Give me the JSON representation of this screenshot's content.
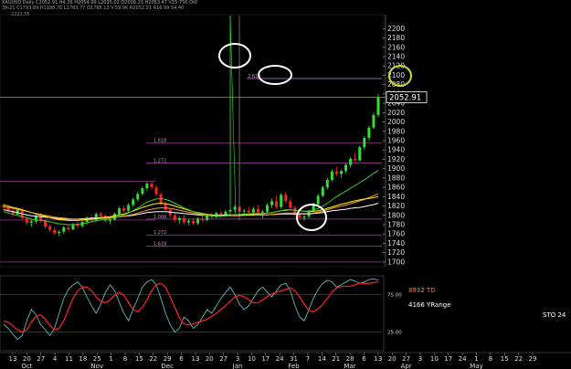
{
  "header": {
    "line1": "XAUUSD Daily C2052.91 H4.36 H2054.99 L2035.02 O2036.23 H2053.47 V15.75K Ot0",
    "line2": "39-21 C1793.89 H1188.76 L1783.77 O1788.12 V:59.9K R2052.51 R16.99 S4.40",
    "line3": "2222.55"
  },
  "last_price_label": "2052.91",
  "indicator_labels": {
    "td": "8932 TD",
    "yrange": "4166 YRange",
    "sto": "STO 24"
  },
  "fib_labels": [
    "2.618",
    "1.618",
    "1.272",
    "1.000",
    "1.272",
    "1.618"
  ],
  "fib_levels": [
    2093,
    1955,
    1912,
    1792,
    1758,
    1734
  ],
  "ma_colors": {
    "ma1": "#ffffff",
    "ma2": "#ff9933",
    "ma3": "#ffee00",
    "ma4": "#33cc33"
  },
  "chart_data": {
    "type": "candlestick",
    "price_axis": {
      "ylim": [
        1690,
        2230
      ],
      "ticks": [
        2200,
        2180,
        2160,
        2140,
        2120,
        2100,
        2080,
        2060,
        2040,
        2020,
        2000,
        1980,
        1960,
        1940,
        1920,
        1900,
        1880,
        1860,
        1840,
        1820,
        1800,
        1780,
        1760,
        1740,
        1720,
        1700
      ]
    },
    "date_axis": {
      "day_labels": [
        "13",
        "20",
        "27",
        "4",
        "11",
        "18",
        "25",
        "1",
        "8",
        "15",
        "22",
        "29",
        "6",
        "13",
        "20",
        "27",
        "3",
        "10",
        "17",
        "24",
        "31",
        "7",
        "14",
        "21",
        "28",
        "6",
        "13",
        "20",
        "27",
        "3",
        "10",
        "17",
        "24",
        "1",
        "8",
        "15",
        "22",
        "29"
      ],
      "month_labels": [
        {
          "label": "Oct",
          "index": 1
        },
        {
          "label": "Nov",
          "index": 6
        },
        {
          "label": "Dec",
          "index": 11
        },
        {
          "label": "Jan",
          "index": 16
        },
        {
          "label": "Feb",
          "index": 20
        },
        {
          "label": "Mar",
          "index": 24
        },
        {
          "label": "Apr",
          "index": 28
        },
        {
          "label": "May",
          "index": 33
        }
      ]
    },
    "candles": [
      [
        1822,
        1826,
        1812,
        1817
      ],
      [
        1817,
        1821,
        1806,
        1810
      ],
      [
        1810,
        1814,
        1798,
        1802
      ],
      [
        1802,
        1815,
        1800,
        1812
      ],
      [
        1812,
        1816,
        1790,
        1794
      ],
      [
        1794,
        1798,
        1780,
        1784
      ],
      [
        1784,
        1790,
        1775,
        1787
      ],
      [
        1787,
        1802,
        1782,
        1798
      ],
      [
        1798,
        1805,
        1785,
        1789
      ],
      [
        1789,
        1792,
        1772,
        1776
      ],
      [
        1776,
        1781,
        1765,
        1769
      ],
      [
        1769,
        1774,
        1758,
        1762
      ],
      [
        1762,
        1768,
        1755,
        1765
      ],
      [
        1765,
        1778,
        1760,
        1774
      ],
      [
        1774,
        1780,
        1766,
        1770
      ],
      [
        1770,
        1784,
        1768,
        1781
      ],
      [
        1781,
        1786,
        1772,
        1777
      ],
      [
        1777,
        1790,
        1773,
        1786
      ],
      [
        1786,
        1798,
        1780,
        1795
      ],
      [
        1795,
        1801,
        1786,
        1790
      ],
      [
        1790,
        1806,
        1787,
        1803
      ],
      [
        1803,
        1808,
        1795,
        1799
      ],
      [
        1799,
        1802,
        1784,
        1788
      ],
      [
        1788,
        1794,
        1781,
        1791
      ],
      [
        1791,
        1806,
        1788,
        1803
      ],
      [
        1803,
        1818,
        1800,
        1815
      ],
      [
        1815,
        1821,
        1806,
        1810
      ],
      [
        1810,
        1826,
        1806,
        1822
      ],
      [
        1822,
        1838,
        1818,
        1834
      ],
      [
        1834,
        1850,
        1830,
        1846
      ],
      [
        1846,
        1862,
        1842,
        1858
      ],
      [
        1858,
        1872,
        1852,
        1868
      ],
      [
        1868,
        1874,
        1855,
        1860
      ],
      [
        1860,
        1866,
        1840,
        1845
      ],
      [
        1845,
        1850,
        1820,
        1825
      ],
      [
        1825,
        1830,
        1808,
        1812
      ],
      [
        1812,
        1816,
        1796,
        1800
      ],
      [
        1800,
        1806,
        1785,
        1790
      ],
      [
        1790,
        1798,
        1782,
        1794
      ],
      [
        1794,
        1800,
        1780,
        1785
      ],
      [
        1785,
        1792,
        1779,
        1788
      ],
      [
        1788,
        1794,
        1780,
        1783
      ],
      [
        1783,
        1796,
        1780,
        1793
      ],
      [
        1793,
        1799,
        1786,
        1790
      ],
      [
        1790,
        1803,
        1787,
        1800
      ],
      [
        1800,
        1806,
        1792,
        1796
      ],
      [
        1796,
        1808,
        1794,
        1805
      ],
      [
        1805,
        1811,
        1795,
        1800
      ],
      [
        1800,
        1812,
        1798,
        1808
      ],
      [
        1808,
        2228,
        1800,
        1812
      ],
      [
        1812,
        1822,
        1806,
        1818
      ],
      [
        1818,
        1822,
        1804,
        1808
      ],
      [
        1808,
        1814,
        1798,
        1810
      ],
      [
        1810,
        1818,
        1804,
        1806
      ],
      [
        1806,
        1818,
        1800,
        1814
      ],
      [
        1814,
        1822,
        1802,
        1806
      ],
      [
        1806,
        1812,
        1794,
        1808
      ],
      [
        1808,
        1826,
        1804,
        1822
      ],
      [
        1822,
        1836,
        1816,
        1830
      ],
      [
        1830,
        1842,
        1814,
        1818
      ],
      [
        1818,
        1848,
        1814,
        1844
      ],
      [
        1844,
        1850,
        1826,
        1830
      ],
      [
        1830,
        1836,
        1812,
        1816
      ],
      [
        1816,
        1820,
        1798,
        1801
      ],
      [
        1801,
        1806,
        1792,
        1795
      ],
      [
        1795,
        1801,
        1788,
        1798
      ],
      [
        1798,
        1812,
        1794,
        1810
      ],
      [
        1810,
        1828,
        1806,
        1824
      ],
      [
        1824,
        1846,
        1820,
        1842
      ],
      [
        1842,
        1864,
        1838,
        1860
      ],
      [
        1860,
        1880,
        1855,
        1876
      ],
      [
        1876,
        1898,
        1872,
        1894
      ],
      [
        1894,
        1904,
        1884,
        1889
      ],
      [
        1889,
        1898,
        1880,
        1895
      ],
      [
        1895,
        1912,
        1890,
        1908
      ],
      [
        1908,
        1925,
        1902,
        1921
      ],
      [
        1921,
        1935,
        1914,
        1918
      ],
      [
        1918,
        1950,
        1915,
        1946
      ],
      [
        1946,
        1970,
        1940,
        1966
      ],
      [
        1966,
        1992,
        1960,
        1988
      ],
      [
        1988,
        2020,
        1984,
        2015
      ],
      [
        2015,
        2060,
        2010,
        2053
      ]
    ],
    "moving_averages": [
      {
        "name": "MA1",
        "color": "#ffffff",
        "values": [
          1812,
          1810,
          1808,
          1806,
          1803,
          1801,
          1799,
          1798,
          1797,
          1796,
          1795,
          1794,
          1793,
          1792,
          1792,
          1792,
          1792,
          1793,
          1793,
          1794,
          1794,
          1795,
          1795,
          1796,
          1796,
          1797,
          1798,
          1799,
          1800,
          1802,
          1804,
          1806,
          1807,
          1808,
          1808,
          1808,
          1807,
          1806,
          1805,
          1804,
          1803,
          1802,
          1801,
          1800,
          1800,
          1800,
          1800,
          1800,
          1801,
          1801,
          1801,
          1801,
          1801,
          1801,
          1801,
          1801,
          1801,
          1801,
          1802,
          1802,
          1803,
          1803,
          1803,
          1803,
          1803,
          1803,
          1803,
          1804,
          1805,
          1806,
          1808,
          1810,
          1811,
          1812,
          1813,
          1815,
          1816,
          1817,
          1819,
          1821,
          1823,
          1826
        ]
      },
      {
        "name": "MA2",
        "color": "#ff9933",
        "values": [
          1818,
          1817,
          1815,
          1813,
          1811,
          1809,
          1806,
          1804,
          1802,
          1800,
          1798,
          1796,
          1795,
          1794,
          1793,
          1792,
          1792,
          1792,
          1792,
          1792,
          1793,
          1793,
          1794,
          1795,
          1796,
          1797,
          1798,
          1800,
          1802,
          1805,
          1808,
          1811,
          1813,
          1815,
          1816,
          1816,
          1815,
          1813,
          1811,
          1809,
          1807,
          1805,
          1803,
          1801,
          1800,
          1799,
          1799,
          1799,
          1799,
          1799,
          1799,
          1799,
          1800,
          1800,
          1800,
          1801,
          1801,
          1801,
          1802,
          1803,
          1804,
          1805,
          1805,
          1805,
          1804,
          1804,
          1804,
          1805,
          1807,
          1809,
          1812,
          1815,
          1818,
          1820,
          1822,
          1825,
          1828,
          1831,
          1834,
          1838,
          1842,
          1846
        ]
      },
      {
        "name": "MA3",
        "color": "#ffee00",
        "values": [
          1822,
          1820,
          1817,
          1815,
          1812,
          1809,
          1806,
          1803,
          1800,
          1798,
          1795,
          1793,
          1791,
          1790,
          1789,
          1789,
          1789,
          1790,
          1791,
          1792,
          1793,
          1795,
          1796,
          1797,
          1799,
          1801,
          1803,
          1806,
          1809,
          1813,
          1817,
          1820,
          1823,
          1825,
          1826,
          1825,
          1823,
          1820,
          1817,
          1814,
          1811,
          1808,
          1806,
          1804,
          1802,
          1801,
          1800,
          1800,
          1800,
          1800,
          1801,
          1801,
          1802,
          1802,
          1803,
          1803,
          1804,
          1805,
          1806,
          1808,
          1810,
          1811,
          1812,
          1811,
          1810,
          1809,
          1808,
          1809,
          1810,
          1812,
          1815,
          1818,
          1821,
          1824,
          1826,
          1829,
          1831,
          1833,
          1835,
          1836,
          1838,
          1840
        ]
      },
      {
        "name": "MA4",
        "color": "#33cc33",
        "values": [
          1808,
          1805,
          1802,
          1800,
          1797,
          1795,
          1792,
          1790,
          1789,
          1788,
          1786,
          1784,
          1782,
          1781,
          1780,
          1780,
          1781,
          1782,
          1784,
          1786,
          1788,
          1790,
          1791,
          1793,
          1795,
          1798,
          1801,
          1805,
          1810,
          1816,
          1822,
          1828,
          1832,
          1835,
          1836,
          1834,
          1831,
          1826,
          1821,
          1816,
          1812,
          1808,
          1805,
          1802,
          1800,
          1799,
          1798,
          1798,
          1799,
          1800,
          1801,
          1802,
          1803,
          1803,
          1804,
          1804,
          1804,
          1805,
          1806,
          1808,
          1810,
          1812,
          1812,
          1811,
          1810,
          1809,
          1809,
          1811,
          1815,
          1820,
          1826,
          1833,
          1840,
          1846,
          1852,
          1858,
          1864,
          1870,
          1876,
          1883,
          1890,
          1896
        ]
      }
    ],
    "oscillator": {
      "ylim": [
        0,
        100
      ],
      "levels": [
        25,
        75
      ],
      "fast": [
        35,
        30,
        22,
        15,
        20,
        40,
        55,
        48,
        35,
        28,
        20,
        30,
        50,
        70,
        82,
        88,
        92,
        85,
        72,
        60,
        50,
        62,
        78,
        88,
        80,
        65,
        50,
        40,
        55,
        70,
        85,
        92,
        95,
        88,
        70,
        50,
        35,
        25,
        30,
        45,
        40,
        30,
        35,
        45,
        55,
        50,
        60,
        70,
        78,
        85,
        75,
        62,
        55,
        60,
        70,
        80,
        85,
        78,
        72,
        80,
        88,
        90,
        80,
        60,
        45,
        40,
        55,
        70,
        82,
        90,
        94,
        92,
        85,
        88,
        92,
        95,
        93,
        90,
        92,
        95,
        96,
        94
      ],
      "slow": [
        40,
        38,
        33,
        28,
        25,
        28,
        38,
        46,
        48,
        42,
        34,
        28,
        30,
        40,
        55,
        70,
        80,
        85,
        85,
        80,
        72,
        66,
        64,
        68,
        74,
        78,
        74,
        64,
        55,
        52,
        58,
        68,
        80,
        88,
        90,
        85,
        72,
        58,
        44,
        36,
        34,
        36,
        38,
        40,
        42,
        46,
        50,
        55,
        60,
        66,
        72,
        74,
        72,
        68,
        64,
        64,
        68,
        72,
        76,
        78,
        80,
        82,
        84,
        80,
        72,
        62,
        54,
        52,
        56,
        62,
        70,
        78,
        84,
        86,
        86,
        86,
        88,
        90,
        90,
        90,
        91,
        92
      ]
    },
    "annotations": [
      "white circle top spike",
      "white oval 2.618 level",
      "yellow circle target",
      "white circle Feb low"
    ]
  }
}
